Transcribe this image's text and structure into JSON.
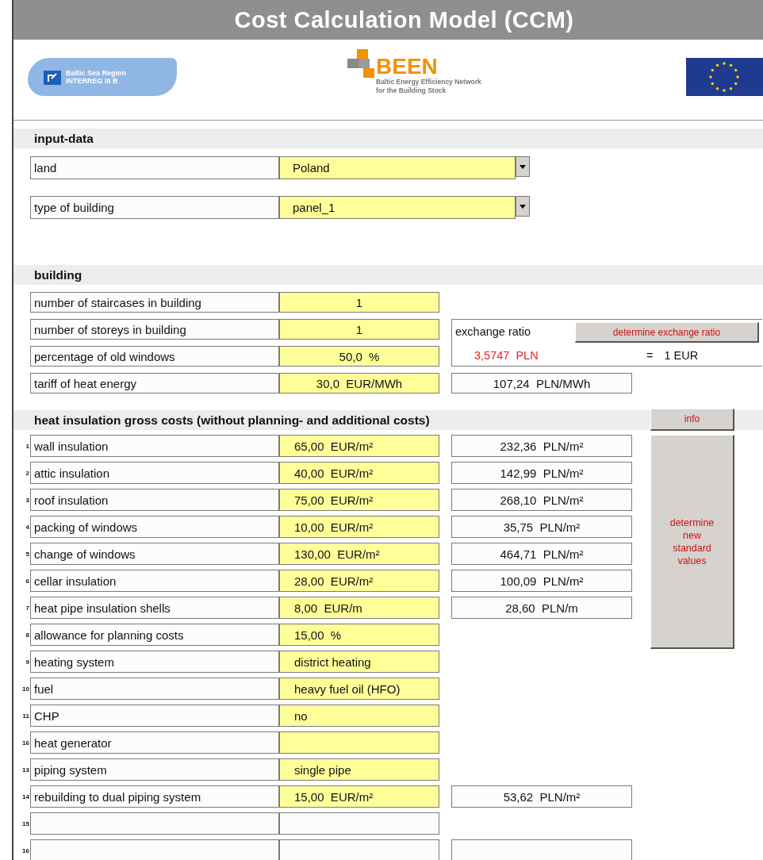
{
  "title": "Cost Calculation Model (CCM)",
  "logos": {
    "left": {
      "line_1": "Baltic Sea Region",
      "line_2": "INTERREG III B"
    },
    "center": {
      "name": "BEEN",
      "line_1": "Baltic Energy Efficiency Network",
      "line_2": "for the Building Stock"
    }
  },
  "input_data": {
    "heading": "input-data",
    "fields": [
      {
        "label": "land",
        "value": "Poland"
      },
      {
        "label": "type of building",
        "value": "panel_1"
      }
    ]
  },
  "building": {
    "heading": "building",
    "fields": [
      {
        "label": "number of staircases in building",
        "value": "1"
      },
      {
        "label": "number of storeys in building",
        "value": "1"
      },
      {
        "label": "percentage of old windows",
        "value": "50,0  %"
      },
      {
        "label": "tariff of heat energy",
        "value": "30,0  EUR/MWh"
      }
    ],
    "exchange": {
      "label": "exchange ratio",
      "button": "determine exchange ratio",
      "rate": "3,5747  PLN",
      "equals": "=",
      "unit": "1 EUR"
    },
    "tariff_converted": "107,24  PLN/MWh"
  },
  "costs": {
    "heading": "heat insulation gross costs (without planning- and additional costs)",
    "info_button": "info",
    "standard_button": "determine new standard values",
    "rows": [
      {
        "number": "1",
        "label": "wall insulation",
        "value": "65,00  EUR/m²",
        "input": true,
        "converted_box": true,
        "converted": "232,36  PLN/m²"
      },
      {
        "number": "2",
        "label": "attic insulation",
        "value": "40,00  EUR/m²",
        "input": true,
        "converted_box": true,
        "converted": "142,99  PLN/m²"
      },
      {
        "number": "3",
        "label": "roof insulation",
        "value": "75,00  EUR/m²",
        "input": true,
        "converted_box": true,
        "converted": "268,10  PLN/m²"
      },
      {
        "number": "4",
        "label": "packing of windows",
        "value": "10,00  EUR/m²",
        "input": true,
        "converted_box": true,
        "converted": "35,75  PLN/m²"
      },
      {
        "number": "5",
        "label": "change of windows",
        "value": "130,00  EUR/m²",
        "input": true,
        "converted_box": true,
        "converted": "464,71  PLN/m²"
      },
      {
        "number": "6",
        "label": "cellar insulation",
        "value": "28,00  EUR/m²",
        "input": true,
        "converted_box": true,
        "converted": "100,09  PLN/m²"
      },
      {
        "number": "7",
        "label": "heat pipe insulation shells",
        "value": "8,00  EUR/m",
        "input": true,
        "converted_box": true,
        "converted": "28,60  PLN/m"
      },
      {
        "number": "8",
        "label": "allowance for planning costs",
        "value": "15,00  %",
        "input": true,
        "converted_box": false
      },
      {
        "number": "9",
        "label": "heating system",
        "value": "district heating",
        "input": true,
        "converted_box": false
      },
      {
        "number": "10",
        "label": "fuel",
        "value": "heavy fuel oil (HFO)",
        "input": true,
        "converted_box": false
      },
      {
        "number": "11",
        "label": "CHP",
        "value": "no",
        "input": true,
        "converted_box": false
      },
      {
        "number": "16",
        "label": "heat generator",
        "input": true,
        "converted_box": false
      },
      {
        "number": "13",
        "label": "piping system",
        "value": "single pipe",
        "input": true,
        "converted_box": false
      },
      {
        "number": "14",
        "label": "rebuilding to dual piping system",
        "value": "15,00  EUR/m²",
        "input": true,
        "converted_box": true,
        "converted": "53,62  PLN/m²"
      },
      {
        "number": "15",
        "input": false,
        "converted_box": false
      },
      {
        "number": "16",
        "input": false,
        "converted_box": true
      }
    ]
  }
}
